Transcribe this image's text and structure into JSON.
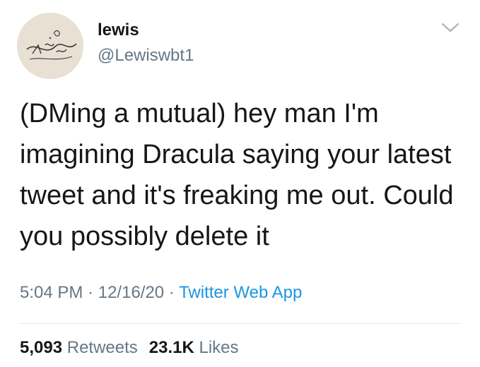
{
  "user": {
    "display_name": "lewis",
    "handle": "@Lewiswbt1",
    "avatar_icon": "handwritten-sketch-avatar"
  },
  "tweet": {
    "text": "(DMing a mutual) hey man I'm imagining Dracula saying your latest tweet and it's freaking me out. Could you possibly delete it",
    "time": "5:04 PM",
    "date": "12/16/20",
    "separator": "·",
    "source": "Twitter Web App"
  },
  "stats": {
    "retweets_count": "5,093",
    "retweets_label": "Retweets",
    "likes_count": "23.1K",
    "likes_label": "Likes"
  },
  "colors": {
    "text": "#14171a",
    "secondary": "#657786",
    "link": "#1b95e0",
    "divider": "#e1e8ed"
  },
  "icons": {
    "menu": "chevron-down-icon"
  }
}
